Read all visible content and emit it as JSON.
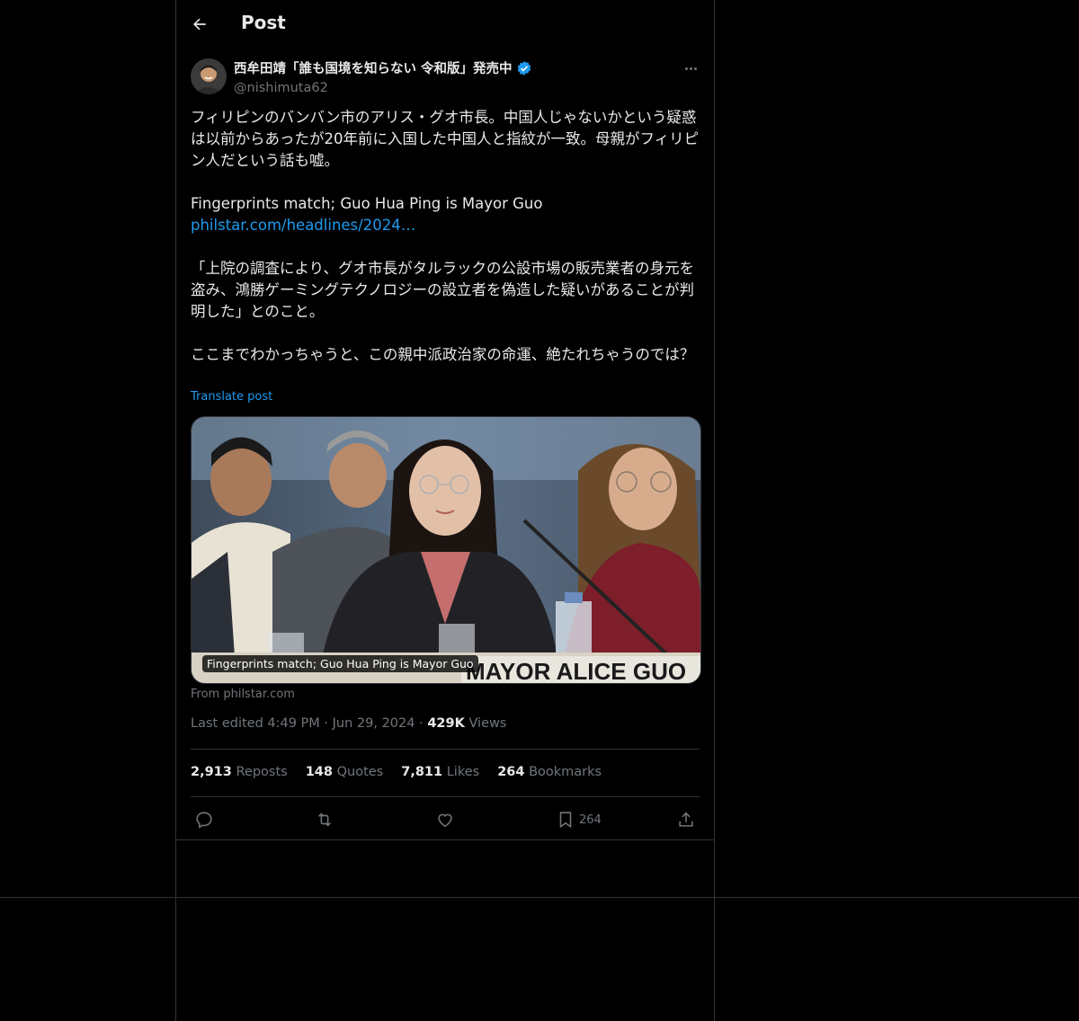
{
  "header": {
    "title": "Post"
  },
  "author": {
    "display_name": "西牟田靖「誰も国境を知らない 令和版」発売中",
    "handle": "@nishimuta62",
    "verified": true
  },
  "post": {
    "para1": "フィリピンのバンバン市のアリス・グオ市長。中国人じゃないかという疑惑は以前からあったが20年前に入国した中国人と指紋が一致。母親がフィリピン人だという話も嘘。",
    "para2_line1": "Fingerprints match; Guo Hua Ping is Mayor Guo",
    "para2_link": "philstar.com/headlines/2024…",
    "para3": "「上院の調査により、グオ市長がタルラックの公設市場の販売業者の身元を盗み、鴻勝ゲーミングテクノロジーの設立者を偽造した疑いがあることが判明した」とのこと。",
    "para4": "ここまでわかっちゃうと、この親中派政治家の命運、絶たれちゃうのでは？",
    "translate_label": "Translate post"
  },
  "media": {
    "caption": "Fingerprints match; Guo Hua Ping is Mayor Guo",
    "source": "From philstar.com",
    "nameplate": "MAYOR ALICE GUO"
  },
  "meta": {
    "edited_label": "Last edited 4:49 PM",
    "date": "Jun 29, 2024",
    "views_count": "429K",
    "views_label": "Views"
  },
  "stats": {
    "reposts_count": "2,913",
    "reposts_label": "Reposts",
    "quotes_count": "148",
    "quotes_label": "Quotes",
    "likes_count": "7,811",
    "likes_label": "Likes",
    "bookmarks_count": "264",
    "bookmarks_label": "Bookmarks"
  },
  "actions": {
    "bookmark_count": "264"
  },
  "colors": {
    "accent": "#1d9bf0",
    "background": "#000000",
    "border": "#2f3336",
    "muted": "#71767b"
  },
  "icons": [
    "back-arrow-icon",
    "verified-badge-icon",
    "more-icon",
    "reply-icon",
    "repost-icon",
    "like-icon",
    "bookmark-icon",
    "share-icon"
  ]
}
